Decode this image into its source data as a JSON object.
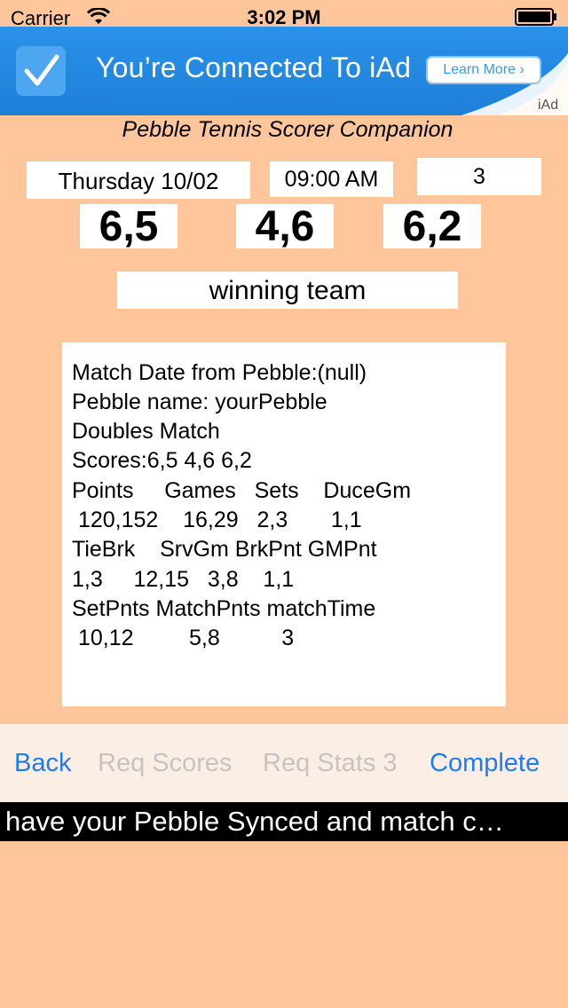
{
  "status_bar": {
    "carrier": "Carrier",
    "time": "3:02 PM",
    "wifi_icon": "wifi-icon",
    "battery_icon": "battery-icon"
  },
  "ad_banner": {
    "icon": "checkmark-icon",
    "text": "You’re Connected To iAd",
    "button_label": "Learn More ›",
    "brand_label": "iAd",
    "accent_color": "#1E7FD8"
  },
  "app": {
    "title": "Pebble Tennis Scorer Companion",
    "background_color": "#FFC69C"
  },
  "match": {
    "date": "Thursday 10/02",
    "time": "09:00 AM",
    "count": "3",
    "scores": [
      "6,5",
      "4,6",
      "6,2"
    ],
    "winner_label": "winning team"
  },
  "stats": {
    "lines": [
      "Match Date from Pebble:(null)",
      "Pebble name: yourPebble",
      "Doubles Match",
      "Scores:6,5 4,6 6,2",
      "Points     Games   Sets    DuceGm",
      " 120,152    16,29   2,3       1,1",
      "TieBrk    SrvGm BrkPnt GMPnt",
      "1,3     12,15   3,8    1,1",
      "SetPnts MatchPnts matchTime",
      " 10,12         5,8          3"
    ]
  },
  "toolbar": {
    "back_label": "Back",
    "req_scores_label": "Req Scores",
    "req_stats_label": "Req Stats 3",
    "complete_label": "Complete",
    "active_color": "#1C7CF3",
    "disabled_color": "#C8C3C0"
  },
  "message": {
    "text": "have your Pebble Synced and match c…"
  }
}
